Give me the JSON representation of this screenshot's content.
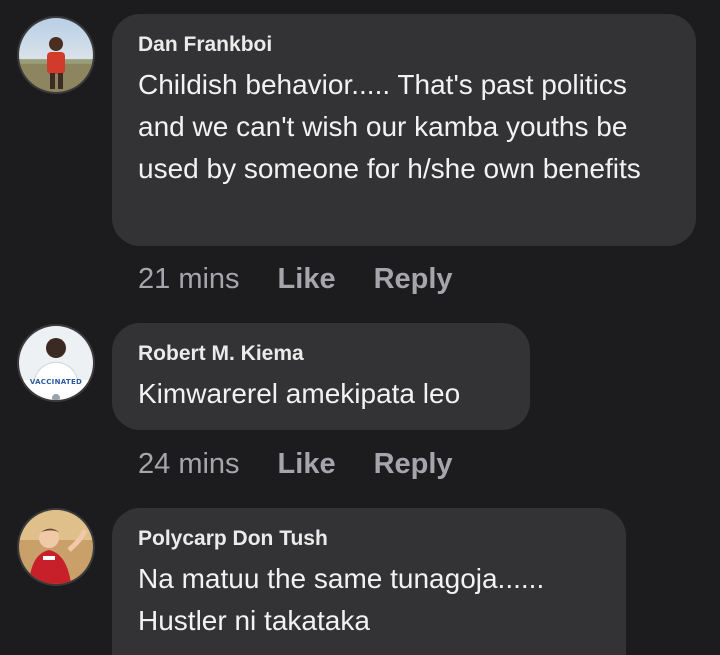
{
  "comments": [
    {
      "author": "Dan Frankboi",
      "text": "Childish behavior..... That's past politics and we can't wish our kamba youths be used by someone for h/she own benefits",
      "time": "21 mins",
      "like_label": "Like",
      "reply_label": "Reply"
    },
    {
      "author": "Robert M. Kiema",
      "avatar_badge": "VACCINATED",
      "text": "Kimwarerel amekipata leo",
      "time": "24 mins",
      "like_label": "Like",
      "reply_label": "Reply"
    },
    {
      "author": "Polycarp Don Tush",
      "text": "Na matuu the same tunagoja...... Hustler ni takataka"
    }
  ]
}
